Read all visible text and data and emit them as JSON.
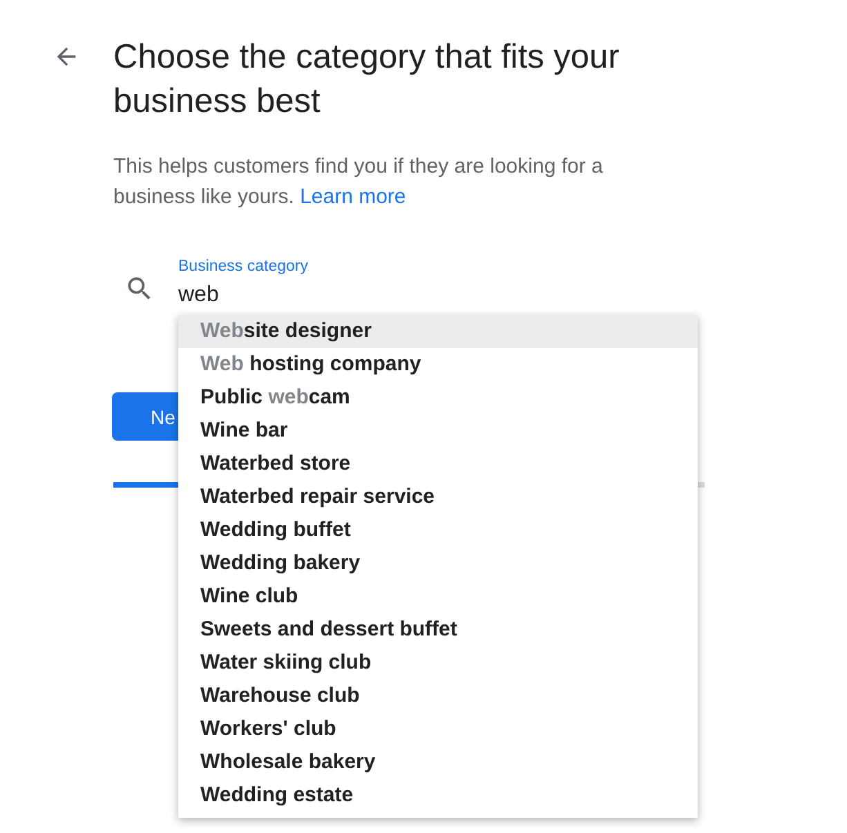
{
  "header": {
    "title": "Choose the category that fits your business best"
  },
  "description": {
    "text": "This helps customers find you if they are looking for a business like yours.",
    "link": "Learn more"
  },
  "field": {
    "label": "Business category",
    "value": "web"
  },
  "suggestions": [
    {
      "selected": true,
      "parts": [
        {
          "text": "Web",
          "match": true
        },
        {
          "text": "site designer",
          "match": false
        }
      ]
    },
    {
      "selected": false,
      "parts": [
        {
          "text": "Web",
          "match": true
        },
        {
          "text": " hosting company",
          "match": false
        }
      ]
    },
    {
      "selected": false,
      "parts": [
        {
          "text": "Public ",
          "match": false
        },
        {
          "text": "web",
          "match": true
        },
        {
          "text": "cam",
          "match": false
        }
      ]
    },
    {
      "selected": false,
      "parts": [
        {
          "text": "Wine bar",
          "match": false
        }
      ]
    },
    {
      "selected": false,
      "parts": [
        {
          "text": "Waterbed store",
          "match": false
        }
      ]
    },
    {
      "selected": false,
      "parts": [
        {
          "text": "Waterbed repair service",
          "match": false
        }
      ]
    },
    {
      "selected": false,
      "parts": [
        {
          "text": "Wedding buffet",
          "match": false
        }
      ]
    },
    {
      "selected": false,
      "parts": [
        {
          "text": "Wedding bakery",
          "match": false
        }
      ]
    },
    {
      "selected": false,
      "parts": [
        {
          "text": "Wine club",
          "match": false
        }
      ]
    },
    {
      "selected": false,
      "parts": [
        {
          "text": "Sweets and dessert buffet",
          "match": false
        }
      ]
    },
    {
      "selected": false,
      "parts": [
        {
          "text": "Water skiing club",
          "match": false
        }
      ]
    },
    {
      "selected": false,
      "parts": [
        {
          "text": "Warehouse club",
          "match": false
        }
      ]
    },
    {
      "selected": false,
      "parts": [
        {
          "text": "Workers' club",
          "match": false
        }
      ]
    },
    {
      "selected": false,
      "parts": [
        {
          "text": "Wholesale bakery",
          "match": false
        }
      ]
    },
    {
      "selected": false,
      "parts": [
        {
          "text": "Wedding estate",
          "match": false
        }
      ]
    }
  ],
  "next_button": {
    "label": "Ne"
  },
  "progress": {
    "level": 0.11
  }
}
